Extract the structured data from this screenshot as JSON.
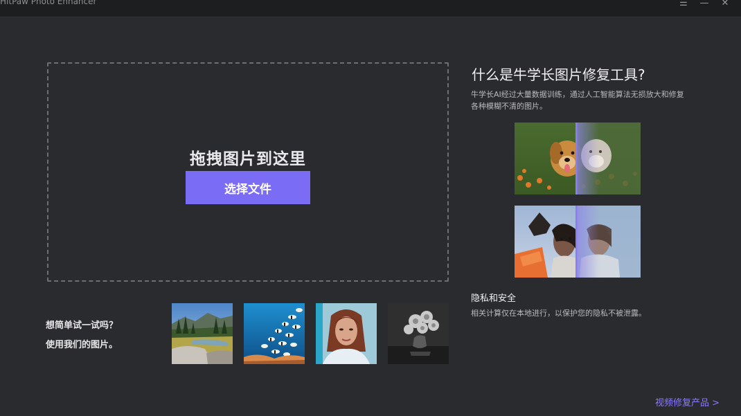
{
  "window": {
    "title": "HitPaw Photo Enhancer",
    "menu_icon": "hamburger-menu-icon",
    "minimize_icon": "minimize-icon",
    "close_icon": "close-icon"
  },
  "dropzone": {
    "title": "拖拽图片到这里",
    "button_label": "选择文件"
  },
  "samples": {
    "prompt_line1": "想简单试一试吗？",
    "prompt_line2": "使用我们的图片。",
    "items": [
      "landscape-sample",
      "fish-sample",
      "portrait-sample",
      "flower-bw-sample"
    ]
  },
  "info": {
    "title": "什么是牛学长图片修复工具?",
    "description": "牛学长AI经过大量数据训练，通过人工智能算法无损放大和修复各种模糊不清的图片。",
    "privacy_title": "隐私和安全",
    "privacy_description": "相关计算仅在本地进行，以保护您的隐私不被泄露。"
  },
  "footer": {
    "video_link": "视频修复产品 >"
  },
  "colors": {
    "accent": "#7b6cf6",
    "link": "#8a7cf6",
    "background": "#2a2b2e",
    "titlebar": "#1d1e20"
  }
}
